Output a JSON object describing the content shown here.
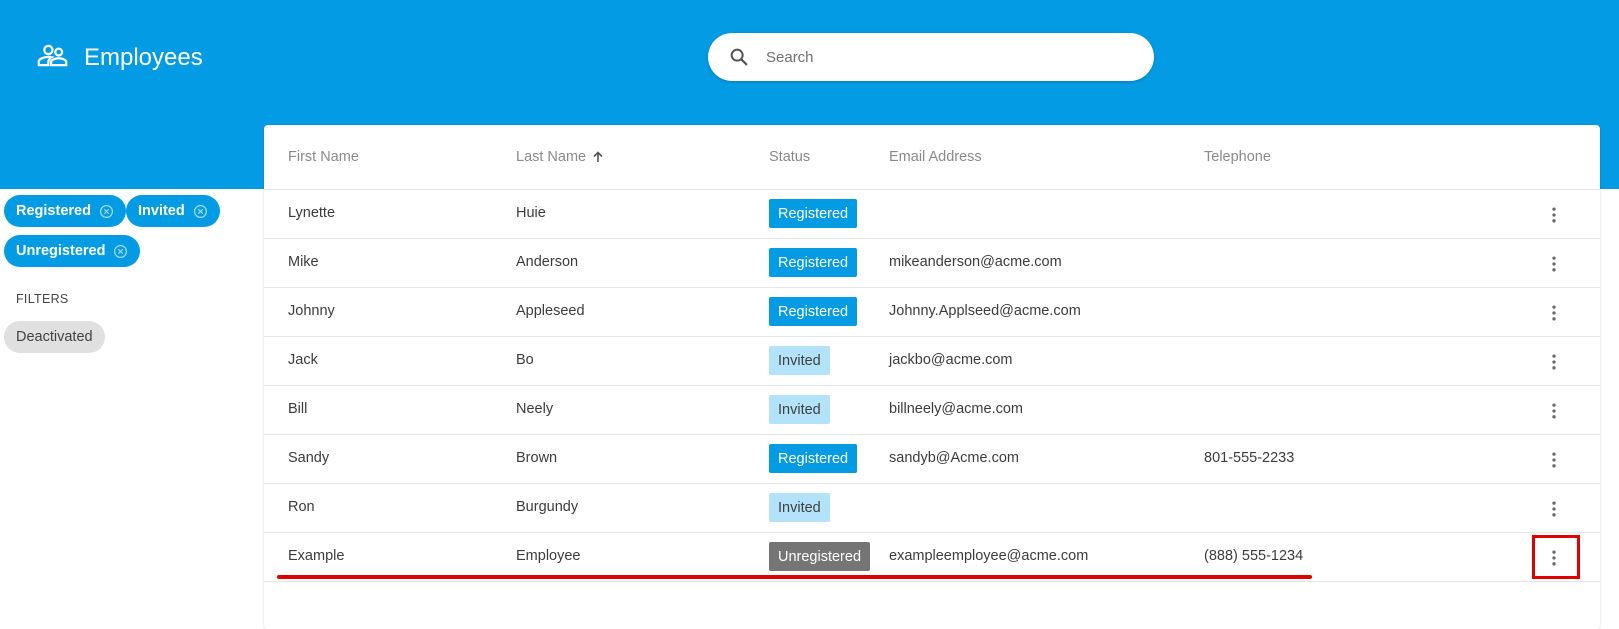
{
  "header": {
    "title": "Employees",
    "icon": "people-icon",
    "background": "#049be5"
  },
  "search": {
    "placeholder": "Search",
    "value": "",
    "icon": "search-icon"
  },
  "status_chips": [
    {
      "label": "Registered"
    },
    {
      "label": "Invited"
    },
    {
      "label": "Unregistered"
    }
  ],
  "filters": {
    "label": "FILTERS",
    "options": [
      {
        "label": "Deactivated"
      }
    ]
  },
  "table": {
    "columns": [
      "First Name",
      "Last Name",
      "Status",
      "Email Address",
      "Telephone"
    ],
    "sorted_column": "Last Name",
    "sort_direction": "ascending",
    "rows": [
      {
        "first": "Lynette",
        "last": "Huie",
        "status": "Registered",
        "email": "",
        "phone": ""
      },
      {
        "first": "Mike",
        "last": "Anderson",
        "status": "Registered",
        "email": "mikeanderson@acme.com",
        "phone": ""
      },
      {
        "first": "Johnny",
        "last": "Appleseed",
        "status": "Registered",
        "email": "Johnny.Applseed@acme.com",
        "phone": ""
      },
      {
        "first": "Jack",
        "last": "Bo",
        "status": "Invited",
        "email": "jackbo@acme.com",
        "phone": ""
      },
      {
        "first": "Bill",
        "last": "Neely",
        "status": "Invited",
        "email": "billneely@acme.com",
        "phone": ""
      },
      {
        "first": "Sandy",
        "last": "Brown",
        "status": "Registered",
        "email": "sandyb@Acme.com",
        "phone": "801-555-2233"
      },
      {
        "first": "Ron",
        "last": "Burgundy",
        "status": "Invited",
        "email": "",
        "phone": ""
      },
      {
        "first": "Example",
        "last": "Employee",
        "status": "Unregistered",
        "email": "exampleemployee@acme.com",
        "phone": "(888) 555-1234"
      }
    ]
  },
  "colors": {
    "registered": "#049be5",
    "invited": "#b3e3fb",
    "unregistered": "#757575",
    "annotation": "#e00000"
  }
}
